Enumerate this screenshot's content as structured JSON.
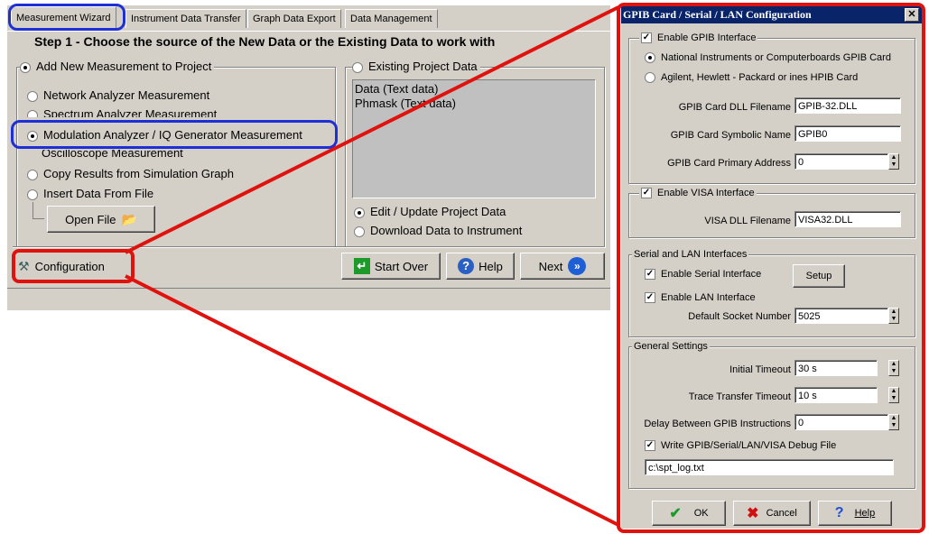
{
  "wizard": {
    "tabs": [
      "Measurement Wizard",
      "Instrument Data Transfer",
      "Graph Data Export",
      "Data Management"
    ],
    "step_title": "Step 1 - Choose the source of the New Data or the Existing Data to work with",
    "add_new_label": "Add New Measurement to Project",
    "existing_label": "Existing Project Data",
    "options": [
      "Network Analyzer Measurement",
      "Spectrum Analyzer Measurement",
      "Modulation Analyzer / IQ Generator Measurement",
      "Oscilloscope Measurement",
      "Copy Results from Simulation Graph",
      "Insert Data From File"
    ],
    "open_file_label": "Open File",
    "project_data": [
      "Data (Text data)",
      "Phmask (Text data)"
    ],
    "edit_update_label": "Edit / Update Project Data",
    "download_label": "Download Data to Instrument",
    "configuration_label": "Configuration",
    "start_over_label": "Start Over",
    "help_label": "Help",
    "next_label": "Next"
  },
  "dialog": {
    "title": "GPIB Card / Serial / LAN Configuration",
    "enable_gpib": "Enable GPIB Interface",
    "ni_card": "National Instruments or Computerboards GPIB Card",
    "agilent_card": "Agilent, Hewlett - Packard or ines HPIB Card",
    "dll_filename_label": "GPIB Card DLL Filename",
    "dll_filename_value": "GPIB-32.DLL",
    "symbolic_name_label": "GPIB Card Symbolic Name",
    "symbolic_name_value": "GPIB0",
    "primary_address_label": "GPIB Card Primary Address",
    "primary_address_value": "0",
    "enable_visa": "Enable VISA Interface",
    "visa_dll_label": "VISA DLL Filename",
    "visa_dll_value": "VISA32.DLL",
    "serial_lan_title": "Serial and LAN Interfaces",
    "enable_serial": "Enable Serial Interface",
    "setup_label": "Setup",
    "enable_lan": "Enable LAN Interface",
    "socket_label": "Default Socket Number",
    "socket_value": "5025",
    "general_title": "General Settings",
    "initial_timeout_label": "Initial Timeout",
    "initial_timeout_value": "30 s",
    "trace_timeout_label": "Trace Transfer Timeout",
    "trace_timeout_value": "10 s",
    "delay_label": "Delay Between GPIB Instructions",
    "delay_value": "0",
    "debug_label": "Write GPIB/Serial/LAN/VISA Debug File",
    "debug_path": "c:\\spt_log.txt",
    "ok_label": "OK",
    "cancel_label": "Cancel",
    "help_label": "Help"
  },
  "colors": {
    "highlight_blue": "#1e2fd6",
    "highlight_red": "#e0120e",
    "titlebar": "#0a246a"
  }
}
